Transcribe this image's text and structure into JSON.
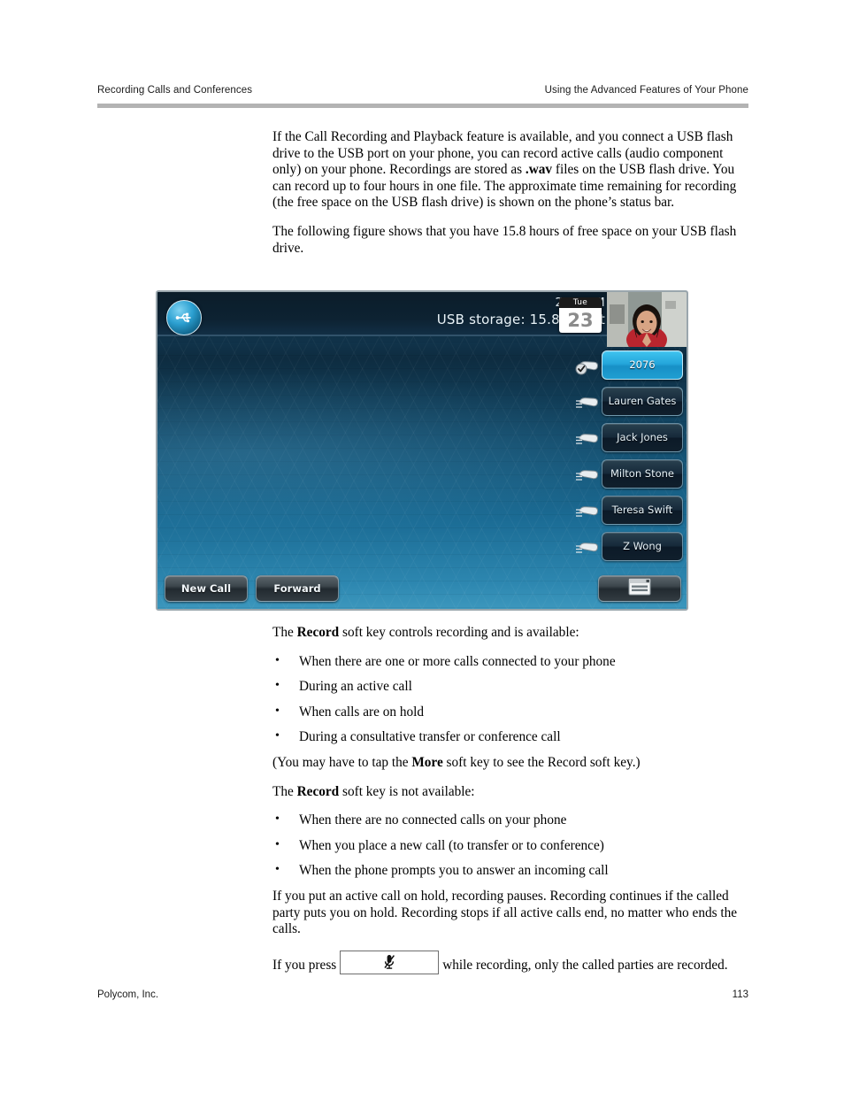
{
  "runhead": {
    "left": "Recording Calls and Conferences",
    "right": "Using the Advanced Features of Your Phone"
  },
  "body": {
    "p1_a": "If the Call Recording and Playback feature is available, and you connect a USB flash drive to the USB port on your phone, you can record active calls (audio component only) on your phone. Recordings are stored as ",
    "p1_b": ".wav",
    "p1_c": " files on the USB flash drive. You can record up to four hours in one file. The approximate time remaining for recording (the free space on the USB flash drive) is shown on the phone’s status bar.",
    "p2": "The following figure shows that you have 15.8 hours of free space on your USB flash drive.",
    "p3_a": "The ",
    "p3_b": "Record",
    "p3_c": " soft key controls recording and is available:",
    "available_items": [
      "When there are one or more calls connected to your phone",
      "During an active call",
      "When calls are on hold",
      "During a consultative transfer or conference call"
    ],
    "p4_a": "(You may have to tap the ",
    "p4_b": "More",
    "p4_c": " soft key to see the Record soft key.)",
    "p5_a": "The ",
    "p5_b": "Record",
    "p5_c": " soft key is not available:",
    "unavailable_items": [
      "When there are no connected calls on your phone",
      "When you place a new call (to transfer or to conference)",
      "When the phone prompts you to answer an incoming call"
    ],
    "p6": "If you put an active call on hold, recording pauses. Recording continues if the called party puts you on hold. Recording stops if all active calls end, no matter who ends the calls.",
    "p7_a": "If you press",
    "p7_key_icon": "mute-microphone-icon",
    "p7_b": "while recording, only the called parties are recorded."
  },
  "figure": {
    "status_bar": {
      "usb_icon": "usb-icon",
      "time": "2:09 PM",
      "usb_storage": "USB storage: 15.8 hr left",
      "calendar": {
        "weekday": "Tue",
        "day": "23"
      },
      "avatar": "contact-photo"
    },
    "calls": [
      {
        "label": "2076",
        "active": true,
        "icon": "handset-connected-icon"
      },
      {
        "label": "Lauren Gates",
        "active": false,
        "icon": "handset-icon"
      },
      {
        "label": "Jack Jones",
        "active": false,
        "icon": "handset-icon"
      },
      {
        "label": "Milton Stone",
        "active": false,
        "icon": "handset-icon"
      },
      {
        "label": "Teresa Swift",
        "active": false,
        "icon": "handset-icon"
      },
      {
        "label": "Z Wong",
        "active": false,
        "icon": "handset-icon"
      }
    ],
    "softkeys": [
      {
        "label": "New Call"
      },
      {
        "label": "Forward"
      }
    ],
    "more_key_icon": "window-list-icon"
  },
  "footer": {
    "company": "Polycom, Inc.",
    "page": "113"
  },
  "colors": {
    "rule": "#b3b3b3",
    "screen_blue": "#1b6c95",
    "active_call": "#24a6db"
  }
}
